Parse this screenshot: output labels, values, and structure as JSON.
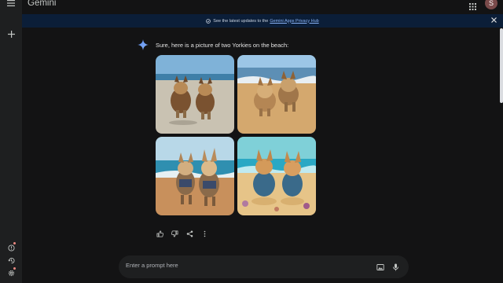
{
  "app": {
    "title": "Gemini",
    "avatar_initial": "S"
  },
  "banner": {
    "text": "See the latest updates to the",
    "link_text": "Gemini Apps Privacy Hub",
    "color": "#0b1e38"
  },
  "response": {
    "text": "Sure, here is a picture of two Yorkies on the beach:",
    "images": [
      {
        "name": "yorkies-beach-1"
      },
      {
        "name": "yorkies-beach-2"
      },
      {
        "name": "yorkies-beach-3"
      },
      {
        "name": "yorkies-beach-4"
      }
    ],
    "actions": [
      "thumb-up-icon",
      "thumb-down-icon",
      "share-icon",
      "more-vert-icon"
    ]
  },
  "prompt": {
    "placeholder": "Enter a prompt here"
  },
  "sidebar": {
    "icons": [
      "menu-icon",
      "new-chat-icon",
      "help-icon",
      "activity-icon",
      "settings-icon"
    ]
  },
  "colors": {
    "background": "#131314",
    "sidebar": "#1e1f20",
    "accent": "#4a8af4",
    "badge": "#f28b82"
  }
}
